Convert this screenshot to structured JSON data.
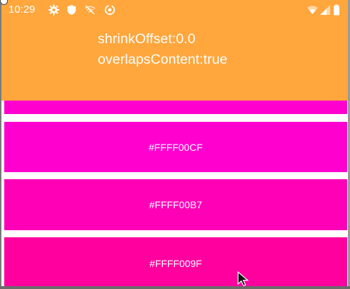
{
  "status_bar": {
    "time": "10:29",
    "icons": [
      "gear-icon",
      "shield-icon",
      "wifi-off-icon",
      "sync-icon"
    ],
    "right_icons": [
      "wifi-icon",
      "signal-icon",
      "battery-icon"
    ]
  },
  "appbar": {
    "background": "#ffa63d",
    "line1": "shrinkOffset:0.0",
    "line2": "overlapsContent:true"
  },
  "tiles": [
    {
      "label": "",
      "color": "#FF00CF"
    },
    {
      "label": "#FFFF00CF",
      "color": "#FF00CF"
    },
    {
      "label": "#FFFF00B7",
      "color": "#FF00B7"
    },
    {
      "label": "#FFFF009F",
      "color": "#FF009F"
    }
  ]
}
